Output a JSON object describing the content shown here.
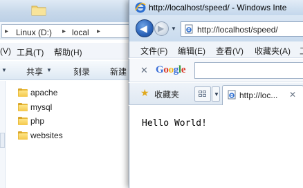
{
  "explorer": {
    "breadcrumb": [
      {
        "label": "Linux (D:)"
      },
      {
        "label": "local"
      }
    ],
    "menu": [
      "(V)",
      "工具(T)",
      "帮助(H)"
    ],
    "toolbar": {
      "share": "共享",
      "burn": "刻录",
      "newfolder": "新建"
    },
    "files": [
      {
        "name": "apache"
      },
      {
        "name": "mysql"
      },
      {
        "name": "php"
      },
      {
        "name": "websites"
      }
    ]
  },
  "ie": {
    "title": "http://localhost/speed/ - Windows Inte",
    "address": "http://localhost/speed/",
    "menu": [
      "文件(F)",
      "编辑(E)",
      "查看(V)",
      "收藏夹(A)",
      "工"
    ],
    "google_logo": [
      "G",
      "o",
      "o",
      "g",
      "l",
      "e"
    ],
    "google_colors": [
      "#3b6fd8",
      "#d93a2b",
      "#f2b31a",
      "#3b6fd8",
      "#2f9a3e",
      "#d93a2b"
    ],
    "favorites_label": "收藏夹",
    "tab_label": "http://loc...",
    "page_text": "Hello World!"
  }
}
